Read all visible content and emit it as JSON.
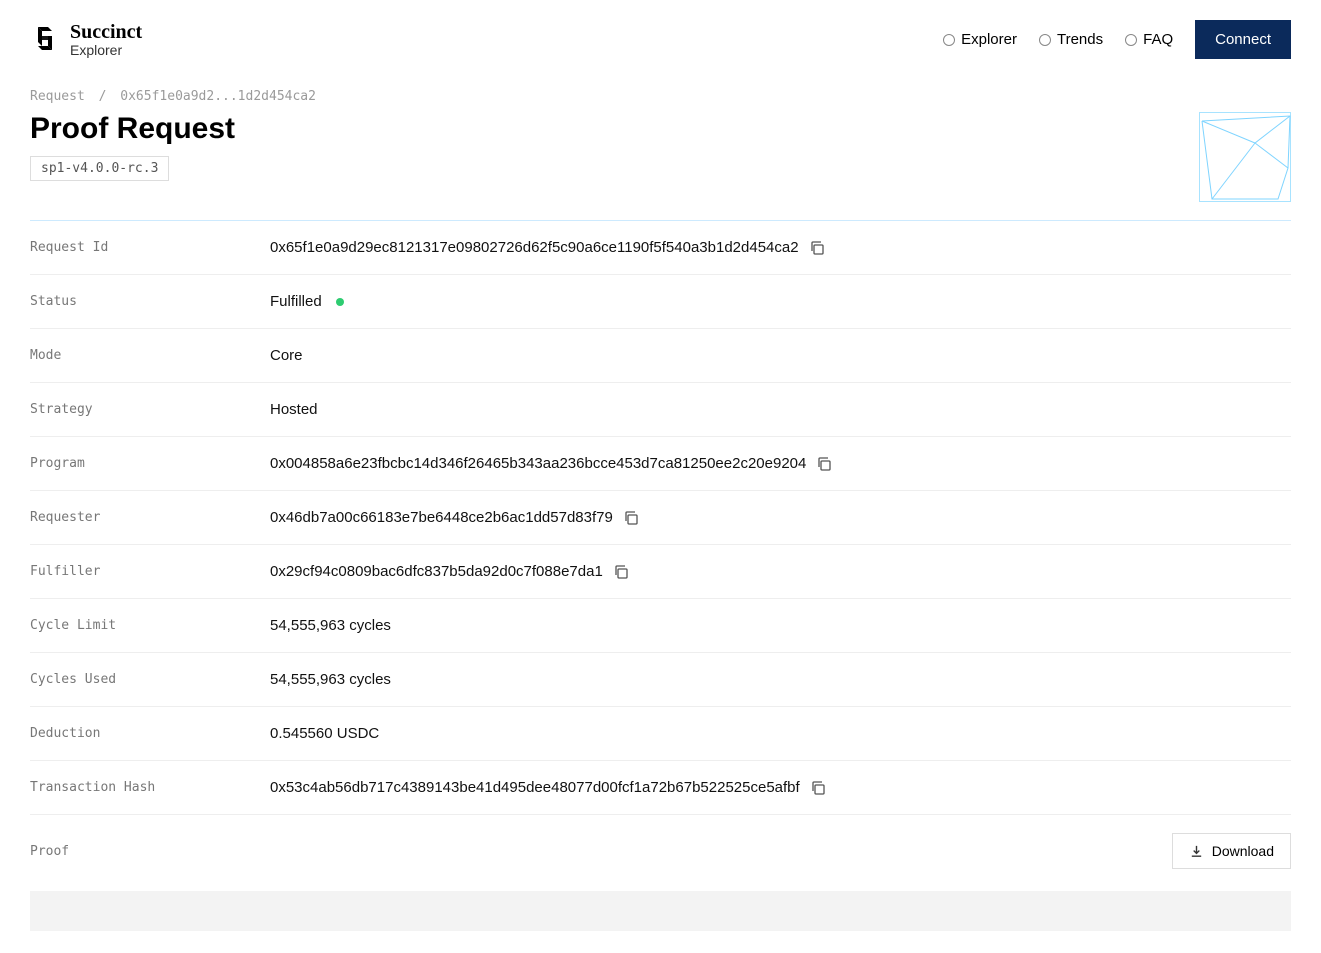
{
  "brand": {
    "name": "Succinct",
    "sub": "Explorer"
  },
  "nav": {
    "explorer": "Explorer",
    "trends": "Trends",
    "faq": "FAQ",
    "connect": "Connect"
  },
  "breadcrumb": {
    "root": "Request",
    "id_short": "0x65f1e0a9d2...1d2d454ca2"
  },
  "page": {
    "title": "Proof Request",
    "version": "sp1-v4.0.0-rc.3"
  },
  "details": {
    "request_id": {
      "label": "Request Id",
      "value": "0x65f1e0a9d29ec8121317e09802726d62f5c90a6ce1190f5f540a3b1d2d454ca2"
    },
    "status": {
      "label": "Status",
      "value": "Fulfilled"
    },
    "mode": {
      "label": "Mode",
      "value": "Core"
    },
    "strategy": {
      "label": "Strategy",
      "value": "Hosted"
    },
    "program": {
      "label": "Program",
      "value": "0x004858a6e23fbcbc14d346f26465b343aa236bcce453d7ca81250ee2c20e9204"
    },
    "requester": {
      "label": "Requester",
      "value": "0x46db7a00c66183e7be6448ce2b6ac1dd57d83f79"
    },
    "fulfiller": {
      "label": "Fulfiller",
      "value": "0x29cf94c0809bac6dfc837b5da92d0c7f088e7da1"
    },
    "cycle_limit": {
      "label": "Cycle Limit",
      "value": "54,555,963 cycles"
    },
    "cycles_used": {
      "label": "Cycles Used",
      "value": "54,555,963 cycles"
    },
    "deduction": {
      "label": "Deduction",
      "value": "0.545560 USDC"
    },
    "tx_hash": {
      "label": "Transaction Hash",
      "value": "0x53c4ab56db717c4389143be41d495dee48077d00fcf1a72b67b522525ce5afbf"
    },
    "proof": {
      "label": "Proof",
      "download": "Download"
    }
  }
}
